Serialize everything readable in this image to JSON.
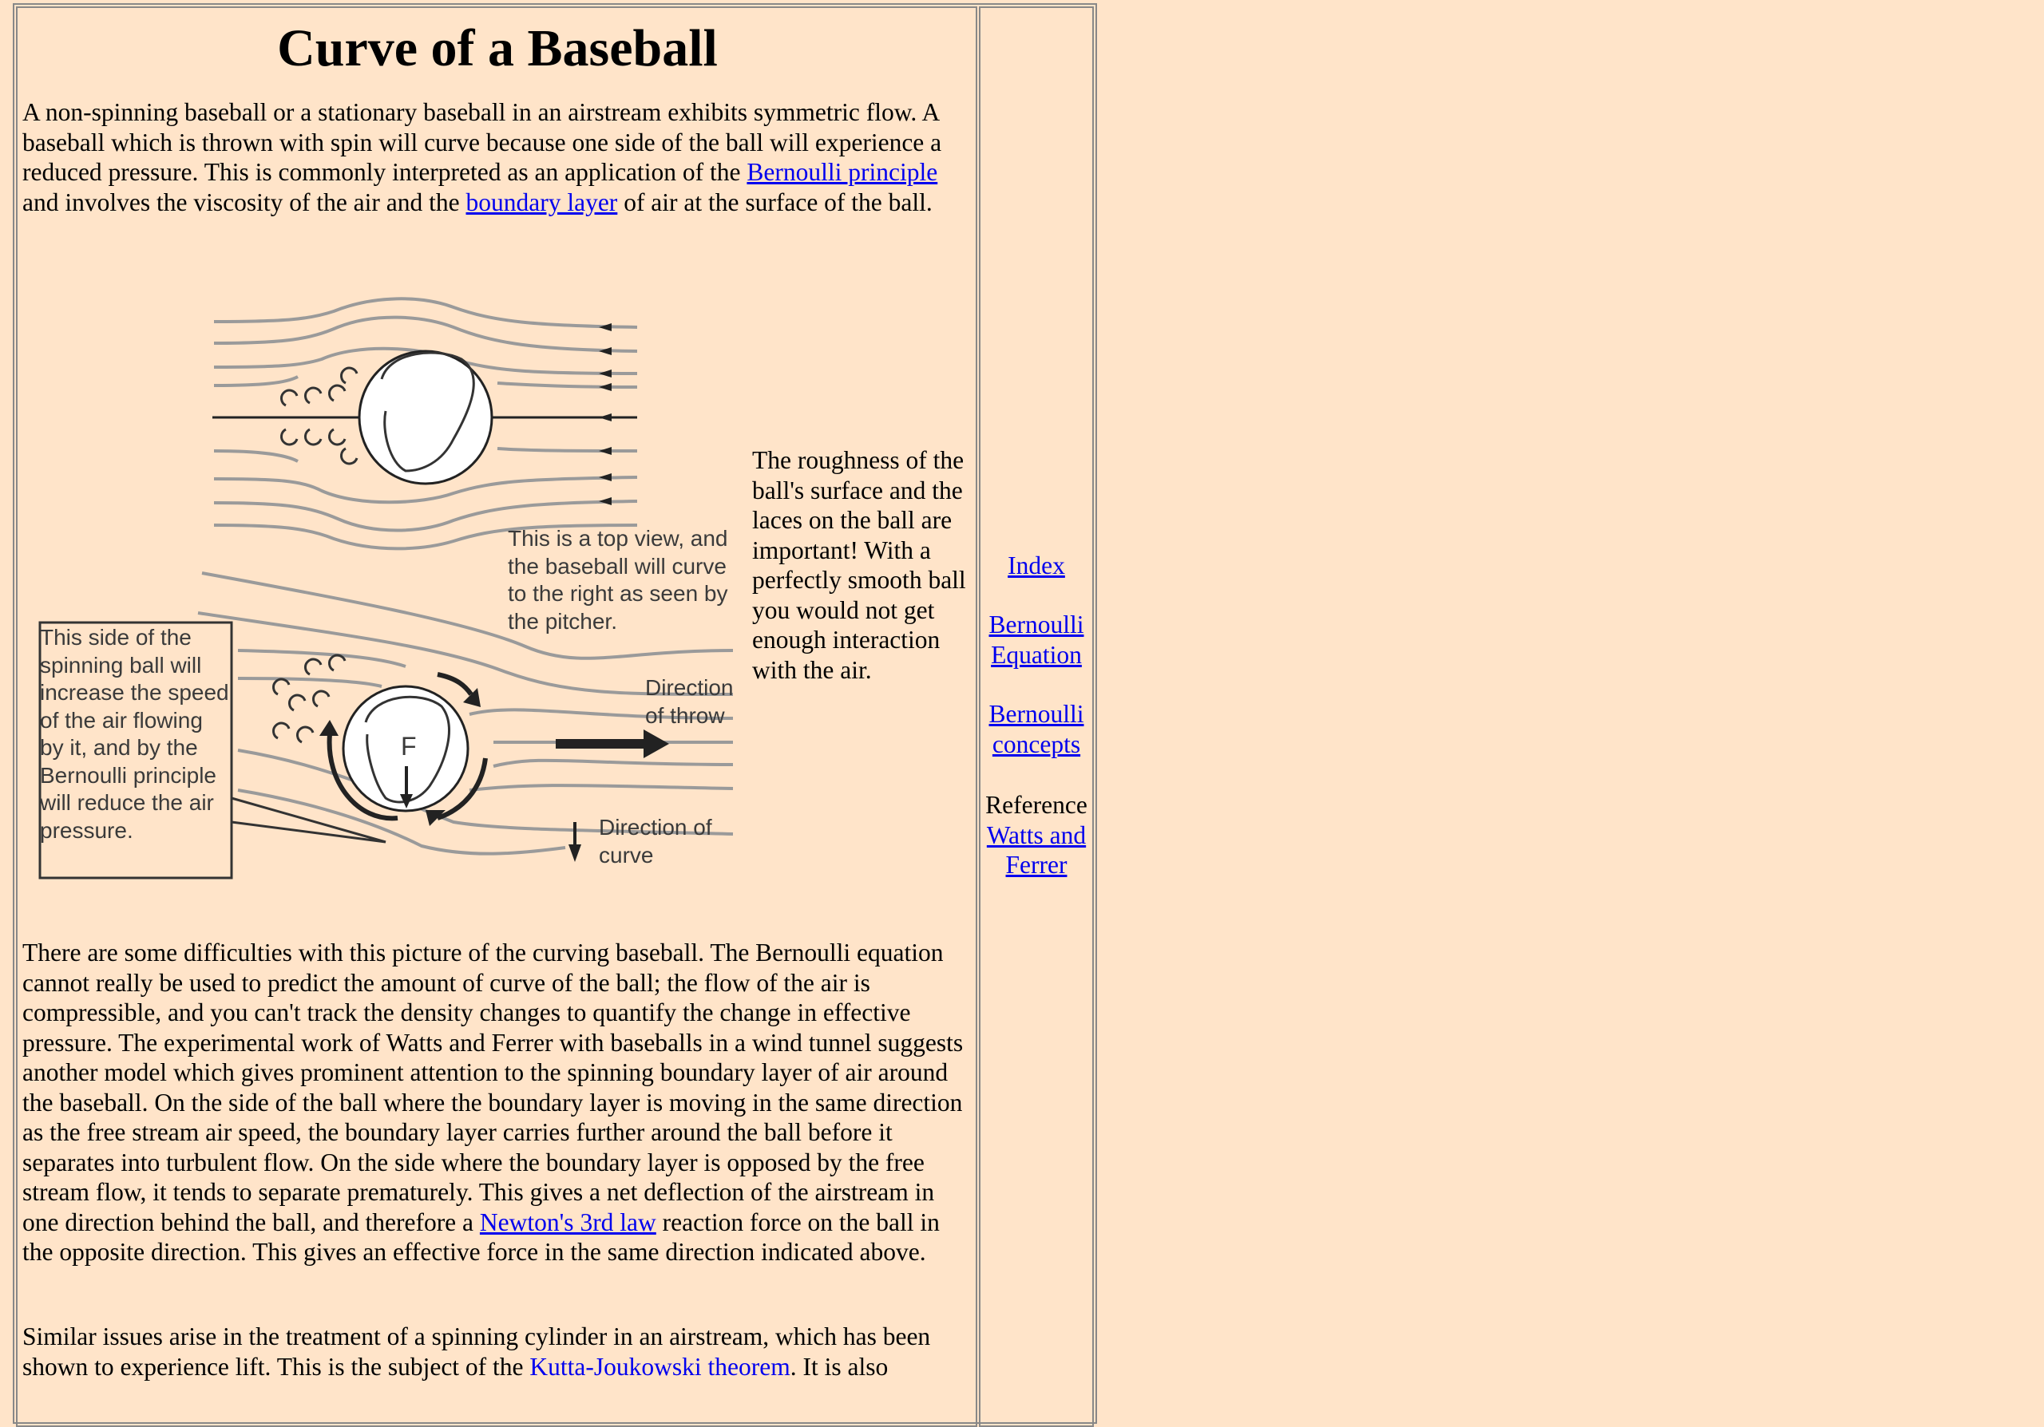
{
  "title": "Curve of a Baseball",
  "intro": {
    "part1": "A non-spinning baseball or a stationary baseball in an airstream exhibits symmetric flow. A baseball which is thrown with spin will curve because one side of the ball will experience a reduced pressure. This is commonly interpreted as an application of the ",
    "link1": "Bernoulli principle",
    "part2": " and involves the viscosity of the air and the ",
    "link2": "boundary layer",
    "part3": " of air at the surface of the ball."
  },
  "figure": {
    "top_view_note": "This is a top view, and the baseball will curve to the right as seen by the pitcher.",
    "side_box_note": "This side of the spinning ball will increase the speed of the air flowing by it, and by the Bernoulli principle will reduce the air pressure.",
    "direction_of_throw": "Direction of throw",
    "direction_of_curve": "Direction of curve",
    "force_label": "F"
  },
  "roughness_note": "The roughness of the ball's surface and the laces on the ball are important! With a perfectly smooth ball you would not get enough interaction with the air.",
  "difficulties": {
    "part1": "There are some difficulties with this picture of the curving baseball. The Bernoulli equation cannot really be used to predict the amount of curve of the ball; the flow of the air is compressible, and you can't track the density changes to quantify the change in effective pressure. The experimental work of Watts and Ferrer with baseballs in a wind tunnel suggests another model which gives prominent attention to the spinning boundary layer of air around the baseball. On the side of the ball where the boundary layer is moving in the same direction as the free stream air speed, the boundary layer carries further around the ball before it separates into turbulent flow. On the side where the boundary layer is opposed by the free stream flow, it tends to separate prematurely. This gives a net deflection of the airstream in one direction behind the ball, and therefore a ",
    "link": "Newton's 3rd law",
    "part2": " reaction force on the ball in the opposite direction. This gives an effective force in the same direction indicated above."
  },
  "similar": {
    "part1": "Similar issues arise in the treatment of a spinning cylinder in an airstream, which has been shown to experience lift. This is the subject of the ",
    "link": "Kutta-Joukowski theorem",
    "part2": ". It is also"
  },
  "sidebar": {
    "index": "Index",
    "bernoulli_equation": "Bernoulli Equation",
    "bernoulli_concepts": "Bernoulli concepts",
    "reference_label": "Reference",
    "reference_link": "Watts and Ferrer"
  },
  "colors": {
    "background": "#FFE4C9",
    "link": "#0000EE",
    "streamline": "#999999"
  }
}
